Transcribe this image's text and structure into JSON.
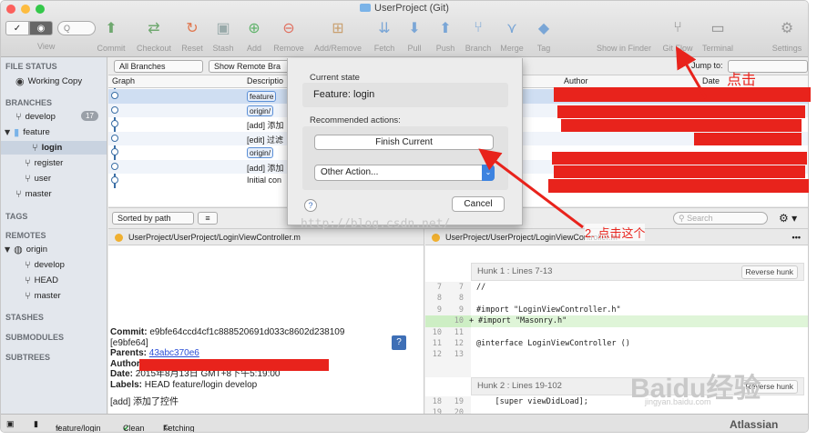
{
  "window": {
    "title": "UserProject (Git)"
  },
  "toolbar": {
    "view_label": "View",
    "search_placeholder": "Q",
    "items": [
      {
        "label": "Commit"
      },
      {
        "label": "Checkout"
      },
      {
        "label": "Reset"
      },
      {
        "label": "Stash"
      },
      {
        "label": "Add"
      },
      {
        "label": "Remove"
      },
      {
        "label": "Add/Remove"
      },
      {
        "label": "Fetch"
      },
      {
        "label": "Pull"
      },
      {
        "label": "Push"
      },
      {
        "label": "Branch"
      },
      {
        "label": "Merge"
      },
      {
        "label": "Tag"
      },
      {
        "label": "Show in Finder"
      },
      {
        "label": "Git Flow"
      },
      {
        "label": "Terminal"
      },
      {
        "label": "Settings"
      }
    ]
  },
  "sidebar": {
    "file_status": "FILE STATUS",
    "working_copy": "Working Copy",
    "branches": "BRANCHES",
    "develop": "develop",
    "develop_badge": "17",
    "feature": "feature",
    "login": "login",
    "register": "register",
    "user": "user",
    "master": "master",
    "tags": "TAGS",
    "remotes": "REMOTES",
    "origin": "origin",
    "r_develop": "develop",
    "r_head": "HEAD",
    "r_master": "master",
    "stashes": "STASHES",
    "submodules": "SUBMODULES",
    "subtrees": "SUBTREES"
  },
  "history": {
    "all_branches": "All Branches",
    "show_remote": "Show Remote Bra",
    "jump_to": "Jump to:",
    "col_graph": "Graph",
    "col_description": "Descriptio",
    "col_author": "Author",
    "col_date": "Date",
    "rows": [
      {
        "text": "feature"
      },
      {
        "text": "origin/"
      },
      {
        "text": "[add] 添加"
      },
      {
        "text": "[edit] 过滤"
      },
      {
        "text": "origin/"
      },
      {
        "text": "[add] 添加"
      },
      {
        "text": "Initial con"
      }
    ]
  },
  "midbar": {
    "sort": "Sorted by path",
    "search_placeholder": "Search"
  },
  "file_left": {
    "path": "UserProject/UserProject/LoginViewController.m"
  },
  "file_right": {
    "path": "UserProject/UserProject/LoginViewController.m"
  },
  "commit": {
    "commit_label": "Commit:",
    "commit_hash": "e9bfe64ccd4cf1c888520691d033c8602d238109",
    "short_hash": "[e9bfe64]",
    "parents_label": "Parents:",
    "parents": "43abc370e6",
    "author_label": "Author:",
    "date_label": "Date:",
    "date": "2015年8月13日 GMT+8下午5:19:00",
    "labels_label": "Labels:",
    "labels": "HEAD feature/login develop",
    "message": "[add] 添加了控件"
  },
  "diff": {
    "hunk1": "Hunk 1 : Lines 7-13",
    "reverse": "Reverse hunk",
    "lines": [
      {
        "a": "7",
        "b": "7",
        "code": "//",
        "add": false
      },
      {
        "a": "8",
        "b": "8",
        "code": "",
        "add": false
      },
      {
        "a": "9",
        "b": "9",
        "code": "#import \"LoginViewController.h\"",
        "add": false
      },
      {
        "a": "",
        "b": "10",
        "code": "#import \"Masonry.h\"",
        "add": true
      },
      {
        "a": "10",
        "b": "11",
        "code": "",
        "add": false
      },
      {
        "a": "11",
        "b": "12",
        "code": "@interface LoginViewController ()",
        "add": false
      },
      {
        "a": "12",
        "b": "13",
        "code": "",
        "add": false
      }
    ],
    "hunk2": "Hunk 2 : Lines 19-102",
    "reverse2": "Reverse hunk",
    "lines2": [
      {
        "a": "18",
        "b": "19",
        "code": "    [super viewDidLoad];"
      },
      {
        "a": "19",
        "b": "20",
        "code": ""
      }
    ]
  },
  "status": {
    "branch": "feature/login",
    "clean": "Clean",
    "fetching": "Fetching",
    "brand": "Atlassian"
  },
  "dialog": {
    "current_state_label": "Current state",
    "current_state": "Feature: login",
    "recommended_label": "Recommended actions:",
    "finish": "Finish Current",
    "other": "Other Action...",
    "cancel": "Cancel",
    "help": "?"
  },
  "annotations": {
    "click": "点击",
    "click_this": "2. 点击这个",
    "watermark": "http://blog.csdn.net/",
    "baidu": "Baidu经验",
    "baidu_url": "jingyan.baidu.com"
  },
  "colors": {
    "accent": "#3d83e0",
    "annotation_red": "#e8231c",
    "selection": "#cfdef2"
  }
}
